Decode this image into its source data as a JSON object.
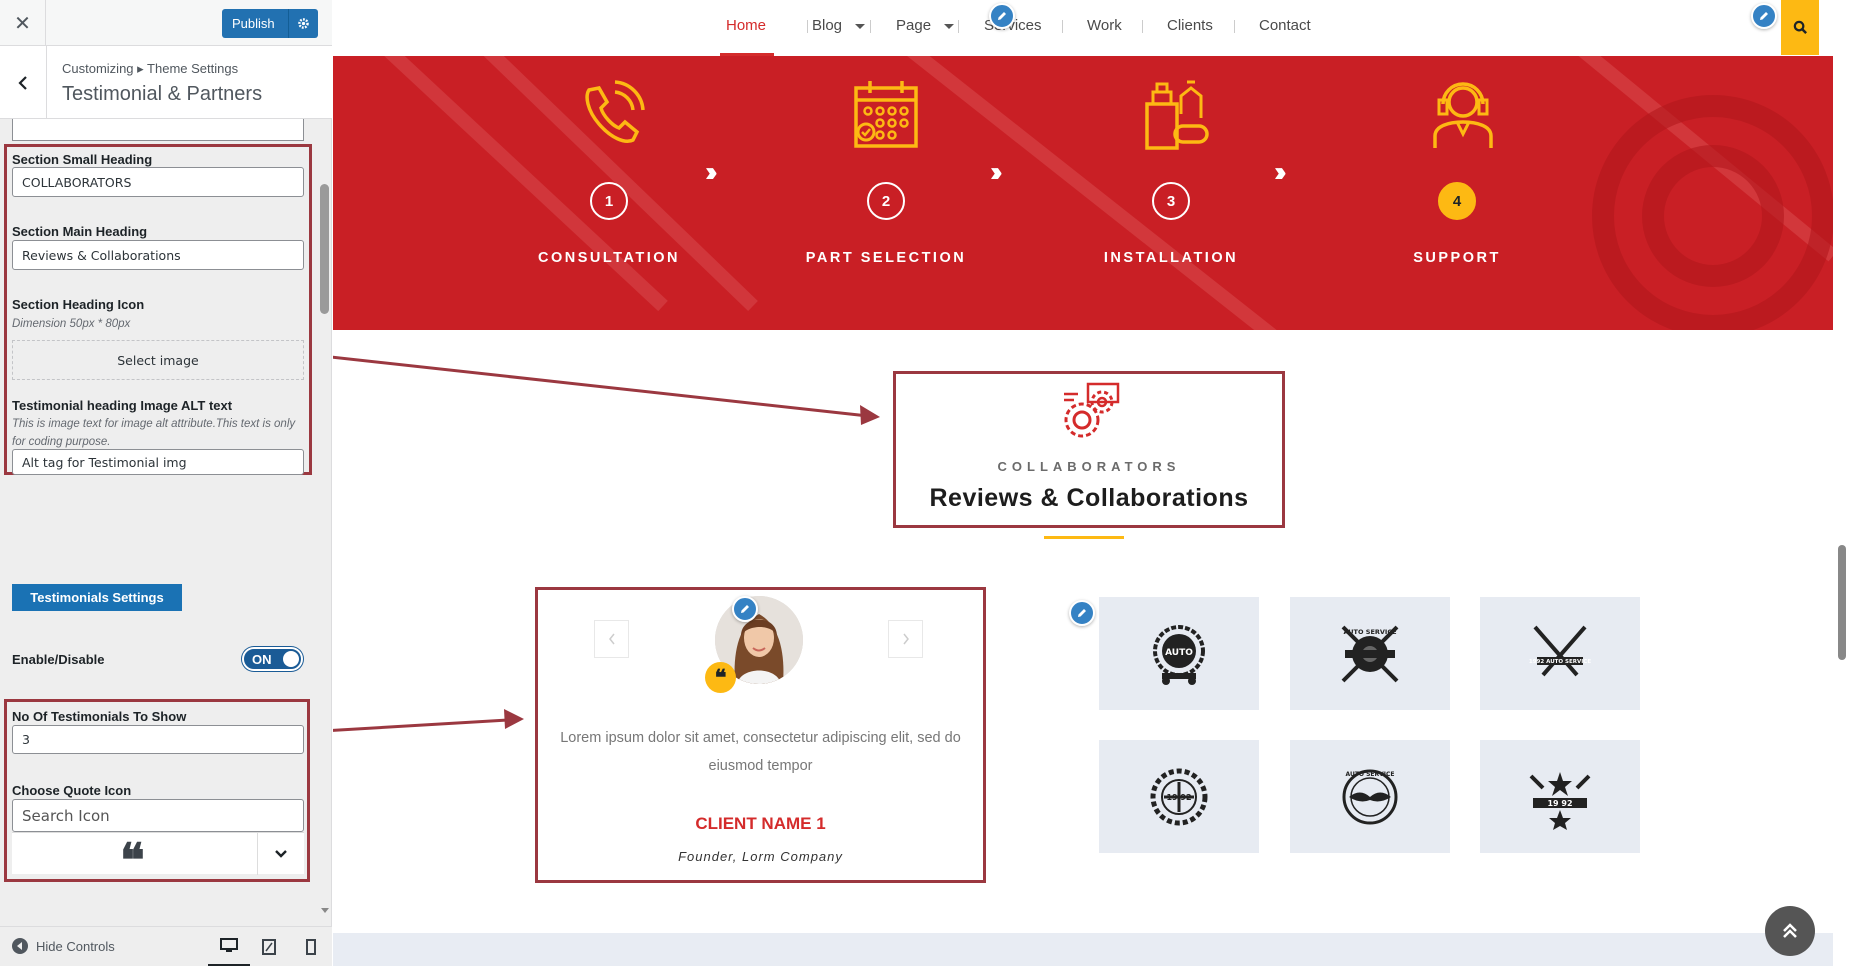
{
  "customizer": {
    "close_label": "✕",
    "publish_label": "Publish",
    "breadcrumb": "Customizing ▸ Theme Settings",
    "section_title": "Testimonial & Partners",
    "fields": {
      "small_heading_label": "Section Small Heading",
      "small_heading_value": "COLLABORATORS",
      "main_heading_label": "Section Main Heading",
      "main_heading_value": "Reviews & Collaborations",
      "heading_icon_label": "Section Heading Icon",
      "heading_icon_desc": "Dimension 50px * 80px",
      "select_image_label": "Select image",
      "alt_label": "Testimonial heading Image ALT text",
      "alt_desc": "This is image text for image alt attribute.This text is only for coding purpose.",
      "alt_value": "Alt tag for Testimonial img",
      "settings_button": "Testimonials Settings",
      "enable_label": "Enable/Disable",
      "toggle_label": "ON",
      "count_label": "No Of Testimonials To Show",
      "count_value": "3",
      "quote_label": "Choose Quote Icon",
      "quote_placeholder": "Search Icon",
      "quote_glyph": "❝"
    },
    "footer": {
      "hide_controls": "Hide Controls"
    },
    "accent": "#2271b1",
    "highlight": "#9b3840"
  },
  "preview": {
    "nav": [
      {
        "label": "Home",
        "active": true
      },
      {
        "label": "Blog"
      },
      {
        "label": "Page"
      },
      {
        "label": "Services"
      },
      {
        "label": "Work"
      },
      {
        "label": "Clients"
      },
      {
        "label": "Contact"
      }
    ],
    "steps": [
      {
        "num": "1",
        "label": "CONSULTATION",
        "icon": "phone-icon"
      },
      {
        "num": "2",
        "label": "PART SELECTION",
        "icon": "calendar-icon"
      },
      {
        "num": "3",
        "label": "INSTALLATION",
        "icon": "cleaning-supplies-icon"
      },
      {
        "num": "4",
        "label": "SUPPORT",
        "icon": "headset-agent-icon"
      }
    ],
    "heading": {
      "small": "COLLABORATORS",
      "main": "Reviews & Collaborations"
    },
    "testimonial": {
      "text": "Lorem ipsum dolor sit amet, consectetur adipiscing elit, sed do eiusmod tempor",
      "name": "CLIENT NAME 1",
      "role": "Founder, Lorm Company"
    },
    "partners": [
      {
        "text": "AUTO"
      },
      {
        "text": "AUTO SERVICE"
      },
      {
        "text": "1992 AUTO SERVICE"
      },
      {
        "text": "19 92"
      },
      {
        "text": "AUTO SERVICE"
      },
      {
        "text": "19 92"
      }
    ],
    "colors": {
      "brand_red": "#c91f25",
      "accent_yellow": "#fdb913",
      "nav_active": "#d42b2b"
    }
  }
}
